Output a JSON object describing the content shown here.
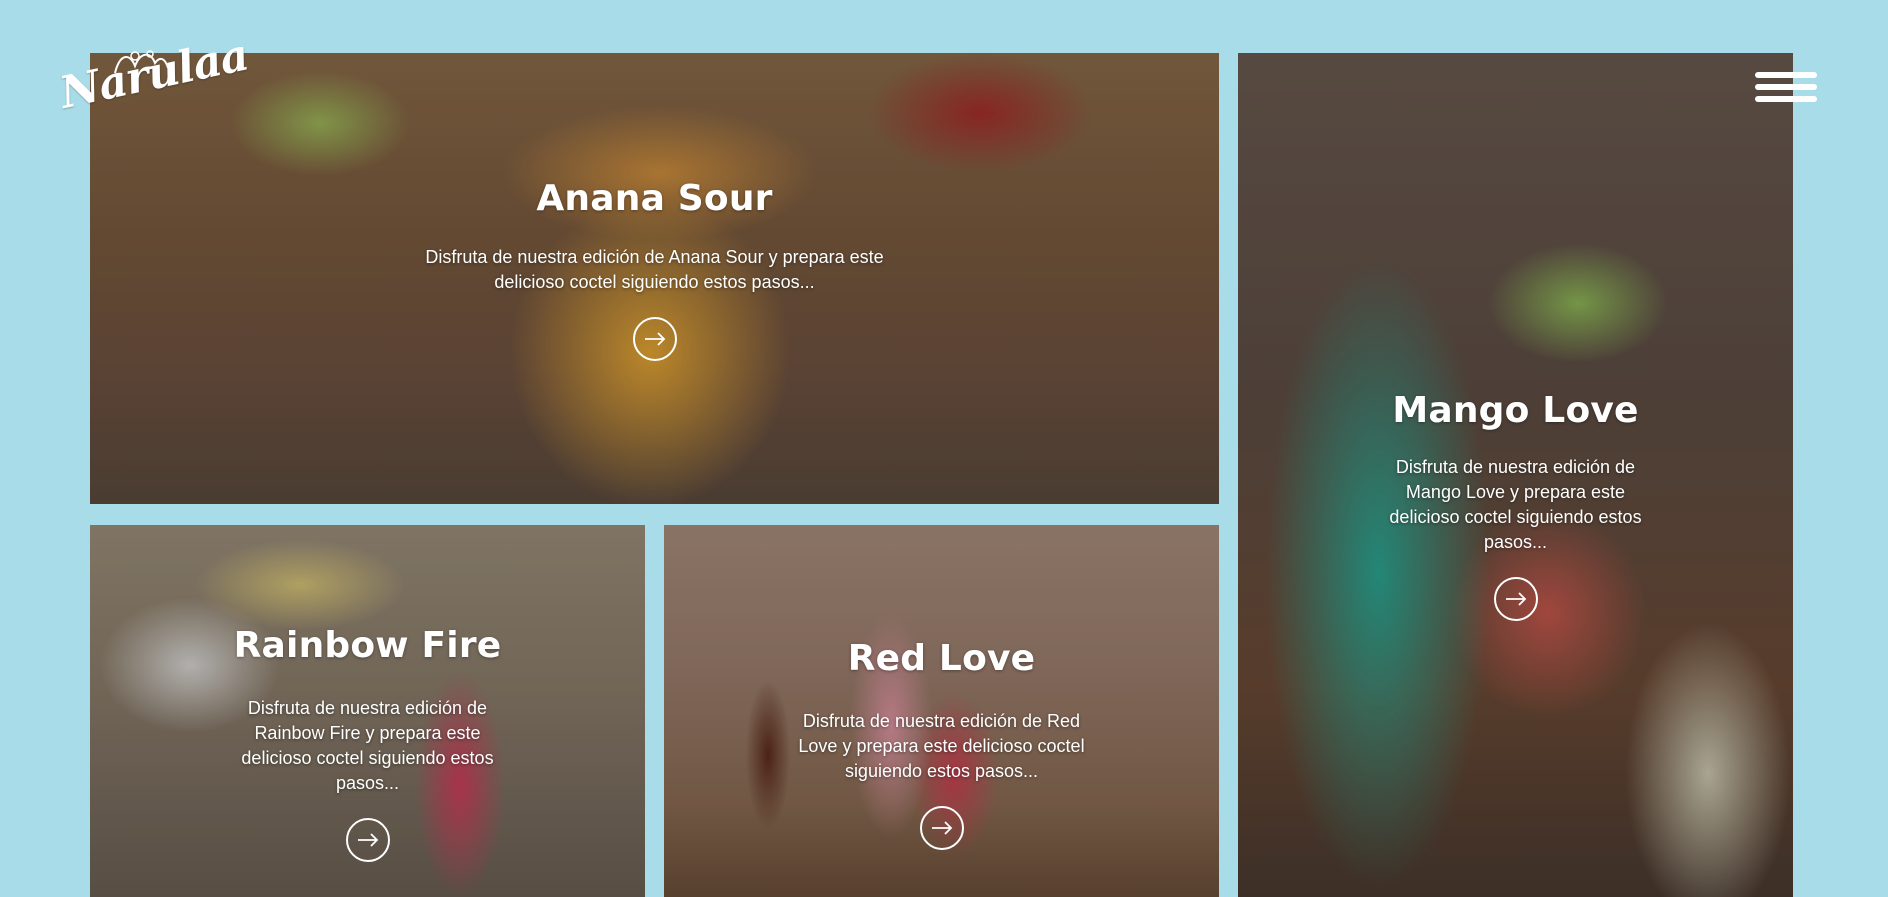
{
  "brand": {
    "logo_text": "Narulaa"
  },
  "navigation": {
    "menu_icon": "hamburger-menu-icon"
  },
  "colors": {
    "background": "#a8dce8",
    "text": "#ffffff"
  },
  "recipes": [
    {
      "title": "Anana Sour",
      "description": "Disfruta de nuestra edición de Anana Sour y prepara este delicioso coctel siguiendo estos pasos...",
      "action_icon": "arrow-right-icon"
    },
    {
      "title": "Mango Love",
      "description": "Disfruta de nuestra edición de Mango Love y prepara este delicioso coctel siguiendo estos pasos...",
      "action_icon": "arrow-right-icon"
    },
    {
      "title": "Rainbow Fire",
      "description": "Disfruta de nuestra edición de Rainbow Fire y prepara este delicioso coctel siguiendo estos pasos...",
      "action_icon": "arrow-right-icon"
    },
    {
      "title": "Red Love",
      "description": "Disfruta de nuestra edición de Red Love y prepara este delicioso coctel siguiendo estos pasos...",
      "action_icon": "arrow-right-icon"
    }
  ]
}
